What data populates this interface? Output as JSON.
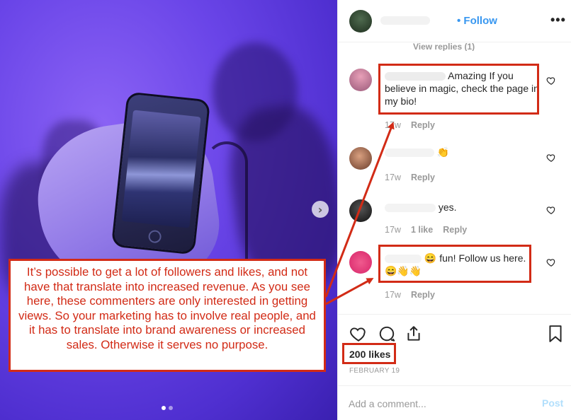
{
  "post_header": {
    "follow_label": "Follow",
    "more_icon": "more-horizontal-icon"
  },
  "thread": {
    "view_replies_label": "View replies (1)"
  },
  "comments": [
    {
      "text": "Amazing If you believe in magic, check the page in my bio!",
      "time": "17w",
      "reply_label": "Reply"
    },
    {
      "text": "👏",
      "time": "17w",
      "reply_label": "Reply"
    },
    {
      "text": "yes.",
      "time": "17w",
      "likes": "1 like",
      "reply_label": "Reply"
    },
    {
      "text_line1": "😄 fun! Follow us here.",
      "text_line2": "😄👋👋",
      "time": "17w",
      "reply_label": "Reply"
    }
  ],
  "actions": {
    "like_icon": "heart-icon",
    "comment_icon": "comment-icon",
    "share_icon": "share-icon",
    "save_icon": "bookmark-icon",
    "likes_count": "200 likes",
    "date": "FEBRUARY 19"
  },
  "add_comment": {
    "placeholder": "Add a comment...",
    "post_label": "Post"
  },
  "annotation": {
    "text": "It’s possible to get a lot of followers and likes, and not have that translate into increased revenue. As you see here, these commenters are only interested in getting views. So your marketing has to involve real people, and it has to translate into brand awareness or increased sales. Otherwise it serves no purpose.",
    "color": "#d22b16"
  },
  "colors": {
    "accent_blue": "#3897f0",
    "annotation_red": "#d22b16",
    "post_disabled": "#b2dffc",
    "muted_text": "#999999"
  }
}
